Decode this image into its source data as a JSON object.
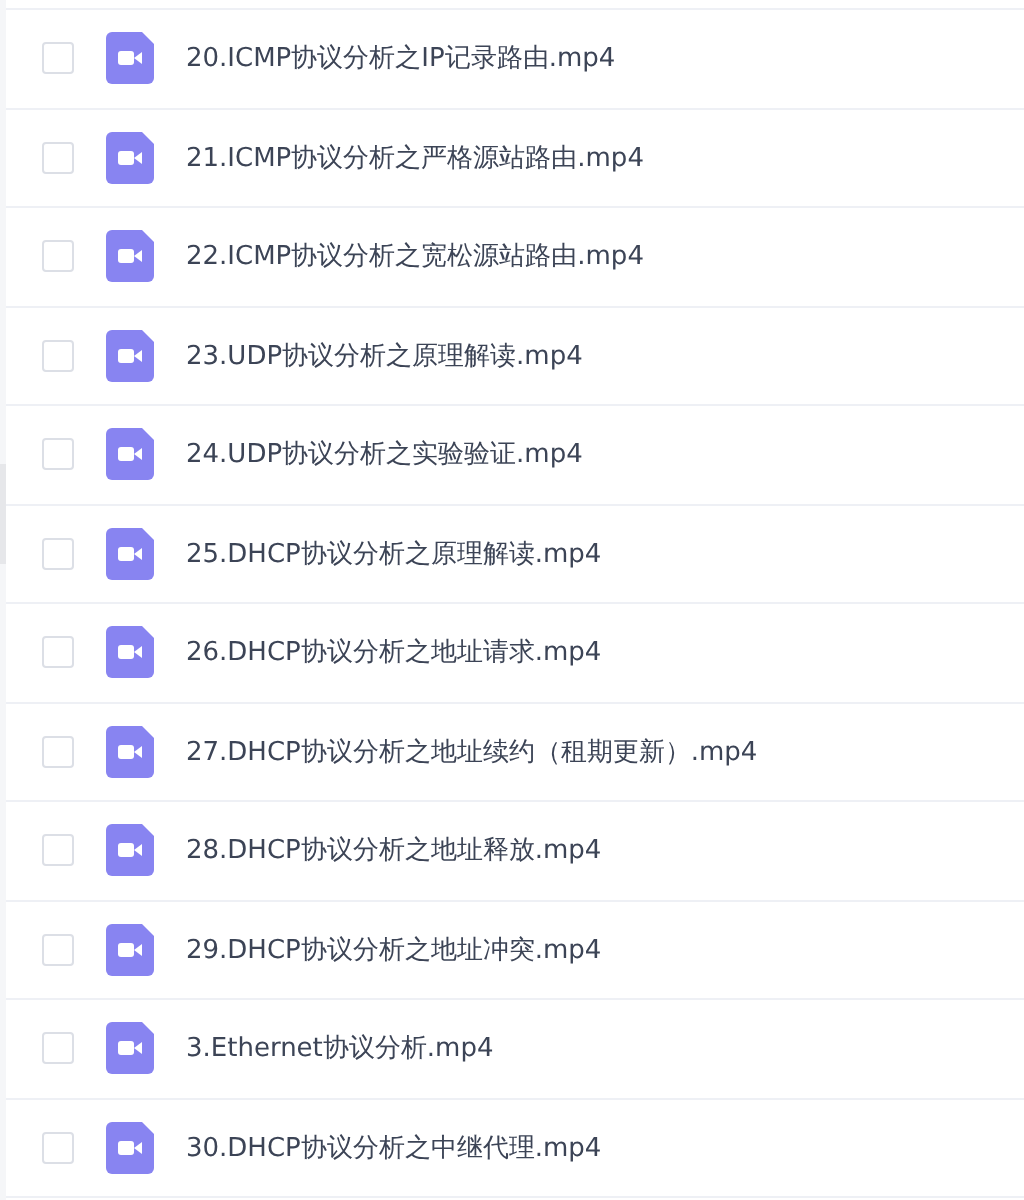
{
  "files": [
    {
      "name": "20.ICMP协议分析之IP记录路由.mp4",
      "checked": false
    },
    {
      "name": "21.ICMP协议分析之严格源站路由.mp4",
      "checked": false
    },
    {
      "name": "22.ICMP协议分析之宽松源站路由.mp4",
      "checked": false
    },
    {
      "name": "23.UDP协议分析之原理解读.mp4",
      "checked": false
    },
    {
      "name": "24.UDP协议分析之实验验证.mp4",
      "checked": false
    },
    {
      "name": "25.DHCP协议分析之原理解读.mp4",
      "checked": false
    },
    {
      "name": "26.DHCP协议分析之地址请求.mp4",
      "checked": false
    },
    {
      "name": "27.DHCP协议分析之地址续约（租期更新）.mp4",
      "checked": false
    },
    {
      "name": "28.DHCP协议分析之地址释放.mp4",
      "checked": false
    },
    {
      "name": "29.DHCP协议分析之地址冲突.mp4",
      "checked": false
    },
    {
      "name": "3.Ethernet协议分析.mp4",
      "checked": false
    },
    {
      "name": "30.DHCP协议分析之中继代理.mp4",
      "checked": false
    }
  ]
}
